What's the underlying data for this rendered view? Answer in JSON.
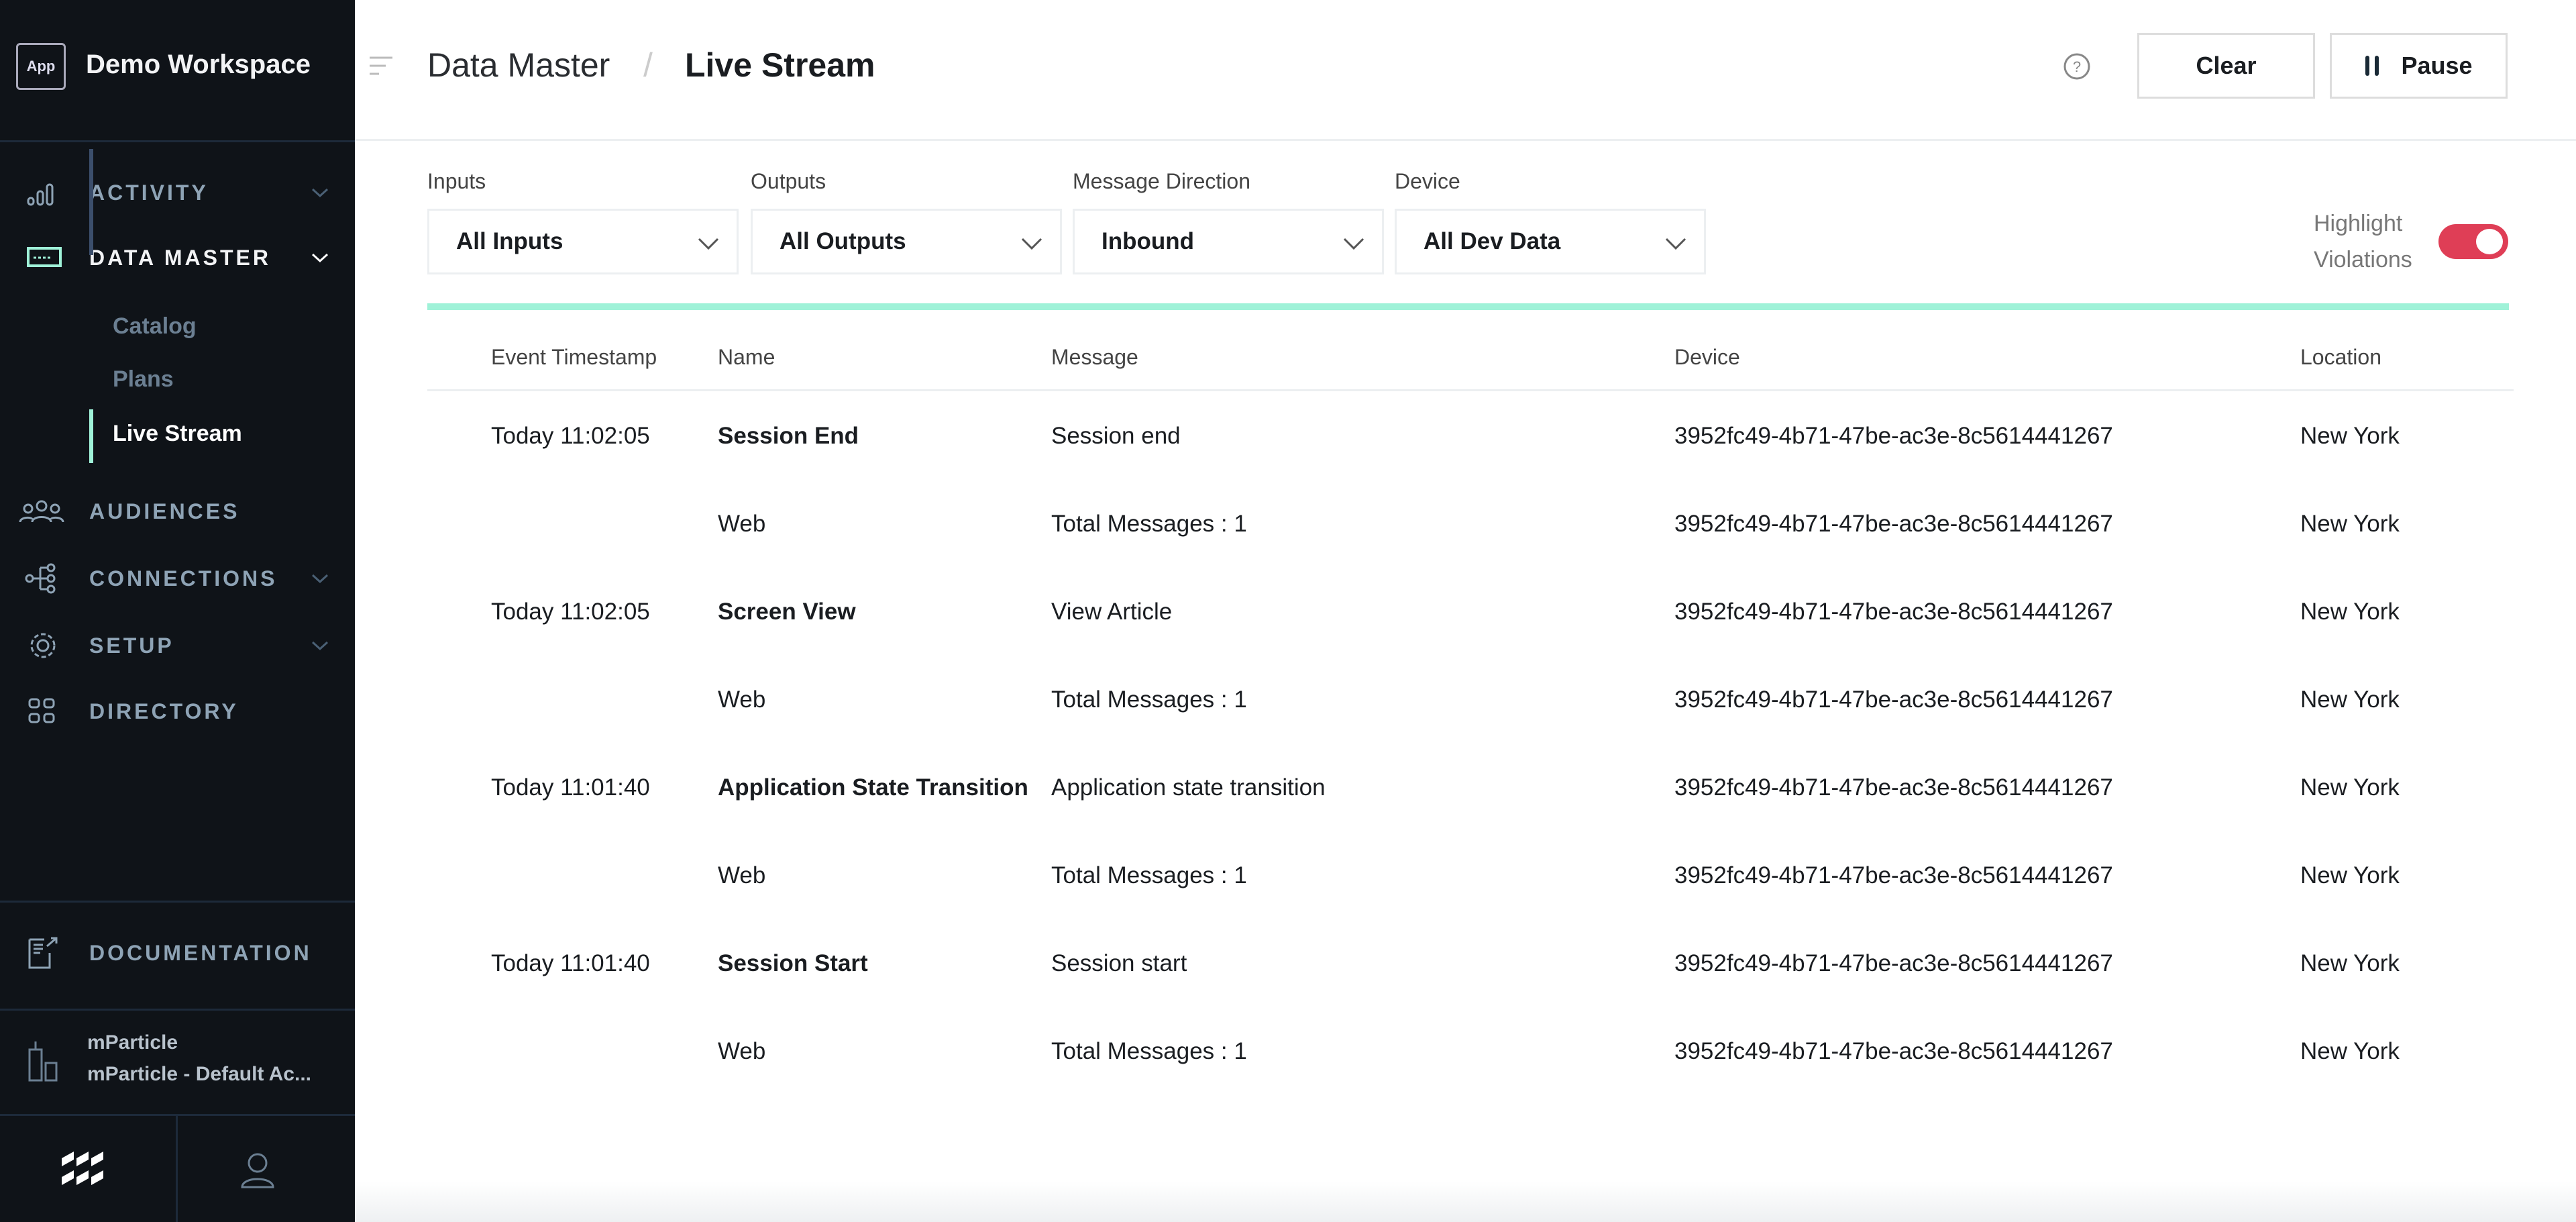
{
  "sidebar": {
    "workspace_badge": "App",
    "workspace_name": "Demo Workspace",
    "nav": [
      {
        "label": "ACTIVITY",
        "icon": "bar-chart-icon"
      },
      {
        "label": "DATA MASTER",
        "icon": "data-master-icon"
      },
      {
        "label": "AUDIENCES",
        "icon": "users-icon"
      },
      {
        "label": "CONNECTIONS",
        "icon": "connections-icon"
      },
      {
        "label": "SETUP",
        "icon": "gear-icon"
      },
      {
        "label": "DIRECTORY",
        "icon": "grid-icon"
      }
    ],
    "sub_items": [
      "Catalog",
      "Plans",
      "Live Stream"
    ],
    "documentation": "DOCUMENTATION",
    "org_name": "mParticle",
    "org_account": "mParticle - Default Ac..."
  },
  "header": {
    "breadcrumb_parent": "Data Master",
    "breadcrumb_current": "Live Stream",
    "clear_label": "Clear",
    "pause_label": "Pause"
  },
  "filters": [
    {
      "label": "Inputs",
      "value": "All Inputs"
    },
    {
      "label": "Outputs",
      "value": "All Outputs"
    },
    {
      "label": "Message Direction",
      "value": "Inbound"
    },
    {
      "label": "Device",
      "value": "All Dev Data"
    }
  ],
  "highlight": {
    "line1": "Highlight",
    "line2": "Violations",
    "enabled": true,
    "color": "#df3e56"
  },
  "table": {
    "columns": [
      "Event Timestamp",
      "Name",
      "Message",
      "Device",
      "Location"
    ],
    "rows": [
      {
        "ts": "Today 11:02:05",
        "name": "Session End",
        "message": "Session end",
        "device": "3952fc49-4b71-47be-ac3e-8c5614441267",
        "location": "New York"
      },
      {
        "ts": "",
        "name": "Web",
        "message": "Total Messages : 1",
        "device": "3952fc49-4b71-47be-ac3e-8c5614441267",
        "location": "New York"
      },
      {
        "ts": "Today 11:02:05",
        "name": "Screen View",
        "message": "View Article",
        "device": "3952fc49-4b71-47be-ac3e-8c5614441267",
        "location": "New York"
      },
      {
        "ts": "",
        "name": "Web",
        "message": "Total Messages : 1",
        "device": "3952fc49-4b71-47be-ac3e-8c5614441267",
        "location": "New York"
      },
      {
        "ts": "Today 11:01:40",
        "name": "Application State Transition",
        "message": "Application state transition",
        "device": "3952fc49-4b71-47be-ac3e-8c5614441267",
        "location": "New York"
      },
      {
        "ts": "",
        "name": "Web",
        "message": "Total Messages : 1",
        "device": "3952fc49-4b71-47be-ac3e-8c5614441267",
        "location": "New York"
      },
      {
        "ts": "Today 11:01:40",
        "name": "Session Start",
        "message": "Session start",
        "device": "3952fc49-4b71-47be-ac3e-8c5614441267",
        "location": "New York"
      },
      {
        "ts": "",
        "name": "Web",
        "message": "Total Messages : 1",
        "device": "3952fc49-4b71-47be-ac3e-8c5614441267",
        "location": "New York"
      }
    ]
  }
}
